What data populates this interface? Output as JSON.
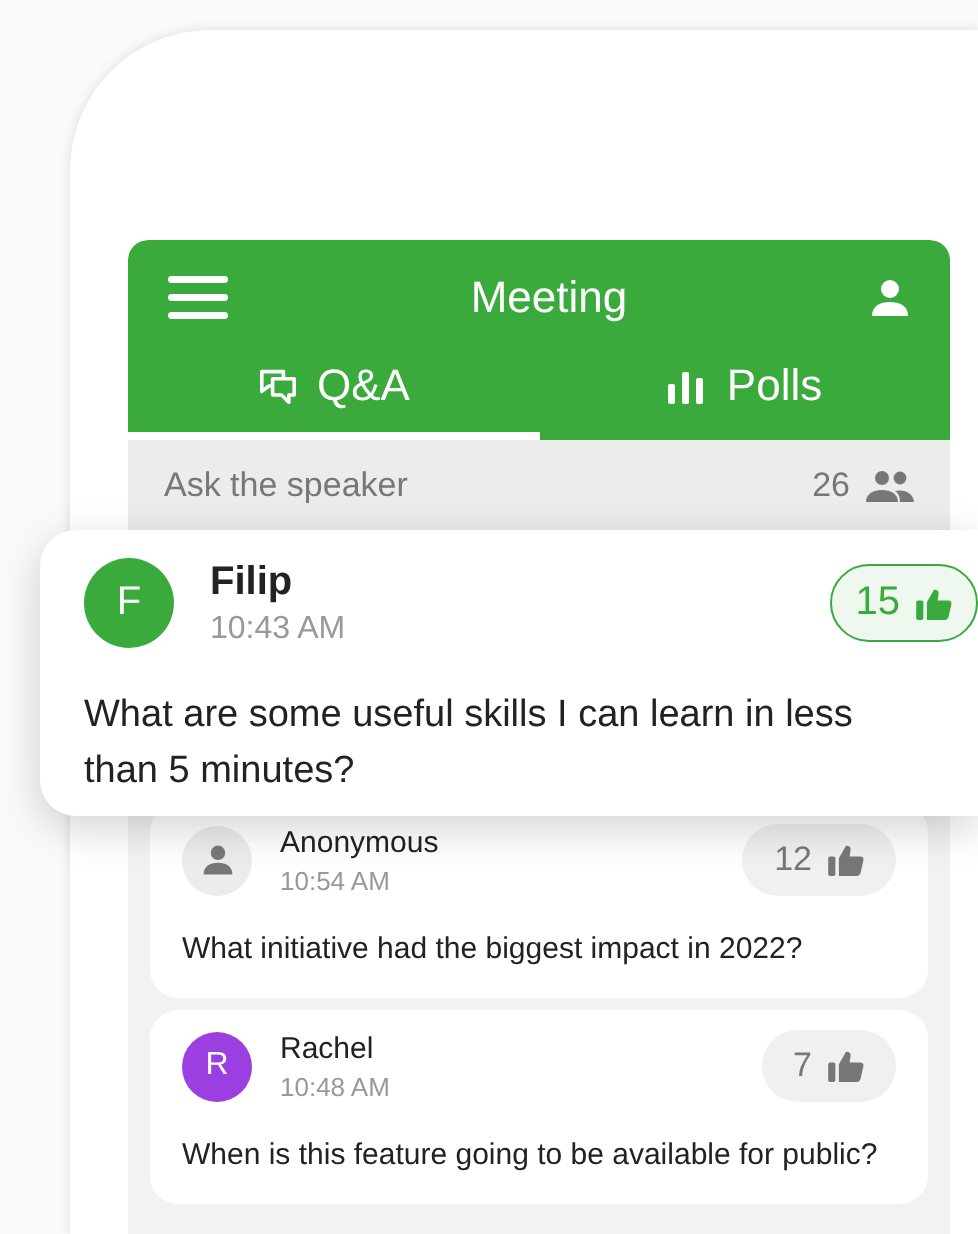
{
  "app_bar": {
    "title": "Meeting"
  },
  "tabs": [
    {
      "label": "Q&A",
      "kind": "qa",
      "selected": true
    },
    {
      "label": "Polls",
      "kind": "polls",
      "selected": false
    }
  ],
  "ask_bar": {
    "placeholder": "Ask the speaker",
    "participants": "26"
  },
  "featured_question": {
    "author": "Filip",
    "initial": "F",
    "kind": "initial",
    "color": "#3aaa3c",
    "time": "10:43 AM",
    "votes": "15",
    "liked": true,
    "text": "What are some useful skills I can learn in less than 5 minutes?"
  },
  "questions": [
    {
      "author": "Anonymous",
      "kind": "anonymous",
      "time": "10:54 AM",
      "votes": "12",
      "liked": false,
      "text": "What initiative had the biggest impact in 2022?"
    },
    {
      "author": "Rachel",
      "initial": "R",
      "kind": "initial",
      "color": "#9b3fe0",
      "time": "10:48 AM",
      "votes": "7",
      "liked": false,
      "text": "When is this feature going to be available for public?"
    }
  ]
}
